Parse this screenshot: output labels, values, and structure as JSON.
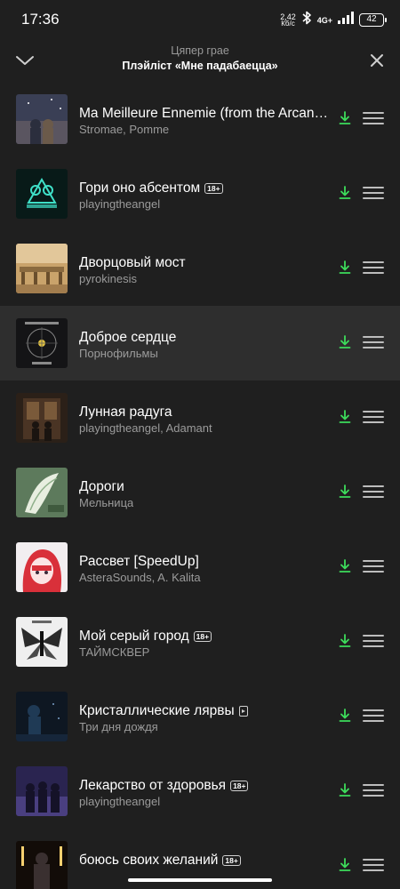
{
  "status_bar": {
    "time": "17:36",
    "net_speed_value": "2,42",
    "net_speed_unit": "Кб/с",
    "network": "4G+",
    "battery": "42",
    "icons": [
      "bluetooth-icon",
      "signal-icon",
      "battery-icon"
    ]
  },
  "header": {
    "subtitle": "Цяпер грае",
    "title": "Плэйліст «Мне падабаецца»",
    "collapse_icon": "chevron-down-icon",
    "close_icon": "close-icon"
  },
  "colors": {
    "background": "#1f1f1f",
    "active_row": "#2e2e2e",
    "download_accent": "#3ddc5b",
    "secondary_text": "#9b9b9b"
  },
  "tracks": [
    {
      "title": "Ma Meilleure Ennemie (from the Arcan…",
      "artist": "Stromae, Pomme",
      "explicit": false,
      "video": false,
      "downloaded": true,
      "active": false
    },
    {
      "title": "Гори оно абсентом",
      "artist": "playingtheangel",
      "explicit": true,
      "video": false,
      "downloaded": true,
      "active": false
    },
    {
      "title": "Дворцовый мост",
      "artist": "pyrokinesis",
      "explicit": false,
      "video": false,
      "downloaded": true,
      "active": false
    },
    {
      "title": "Доброе сердце",
      "artist": "Порнофильмы",
      "explicit": false,
      "video": false,
      "downloaded": true,
      "active": true
    },
    {
      "title": "Лунная радуга",
      "artist": "playingtheangel, Adamant",
      "explicit": false,
      "video": false,
      "downloaded": true,
      "active": false
    },
    {
      "title": "Дороги",
      "artist": "Мельница",
      "explicit": false,
      "video": false,
      "downloaded": true,
      "active": false
    },
    {
      "title": "Рассвет [SpeedUp]",
      "artist": "AsteraSounds, A. Kalita",
      "explicit": false,
      "video": false,
      "downloaded": true,
      "active": false
    },
    {
      "title": "Мой серый город",
      "artist": "ТАЙМСКВЕР",
      "explicit": true,
      "video": false,
      "downloaded": true,
      "active": false
    },
    {
      "title": "Кристаллические лярвы",
      "artist": "Три дня дождя",
      "explicit": false,
      "video": true,
      "downloaded": true,
      "active": false
    },
    {
      "title": "Лекарство от здоровья",
      "artist": "playingtheangel",
      "explicit": true,
      "video": false,
      "downloaded": true,
      "active": false
    },
    {
      "title": "боюсь своих желаний",
      "artist": "",
      "explicit": true,
      "video": false,
      "downloaded": true,
      "active": false
    }
  ],
  "explicit_badge": "18+"
}
